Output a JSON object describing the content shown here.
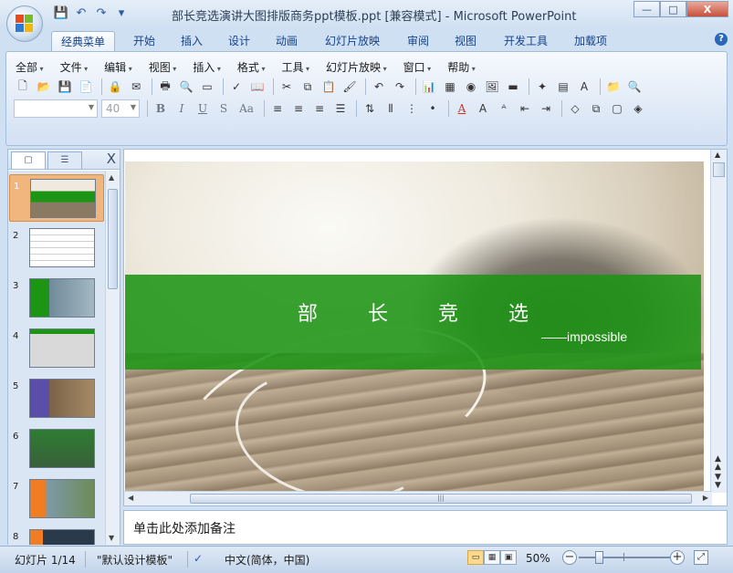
{
  "window": {
    "title": "部长竞选演讲大图排版商务ppt模板.ppt [兼容模式] - Microsoft PowerPoint",
    "controls": {
      "minimize": "—",
      "maximize": "□",
      "close": "X"
    }
  },
  "quick_access": {
    "save": "💾",
    "undo": "↶",
    "redo": "↷",
    "more": "▾"
  },
  "ribbon_tabs": [
    "经典菜单",
    "开始",
    "插入",
    "设计",
    "动画",
    "幻灯片放映",
    "审阅",
    "视图",
    "开发工具",
    "加载项"
  ],
  "active_tab": "经典菜单",
  "help": "?",
  "menu": [
    "全部",
    "文件",
    "编辑",
    "视图",
    "插入",
    "格式",
    "工具",
    "幻灯片放映",
    "窗口",
    "帮助"
  ],
  "font": {
    "name": "",
    "size": "40"
  },
  "format_buttons": {
    "bold": "B",
    "italic": "I",
    "underline": "U",
    "strike": "S",
    "case": "Aa",
    "font_color": "A"
  },
  "left_panel": {
    "tab_slides": "▢",
    "tab_outline": "☰",
    "close": "X",
    "slides": [
      "1",
      "2",
      "3",
      "4",
      "5",
      "6",
      "7",
      "8"
    ],
    "selected": "1"
  },
  "slide": {
    "title": "部长竞选",
    "subtitle": "——impossible"
  },
  "notes": {
    "placeholder": "单击此处添加备注"
  },
  "status": {
    "slide": "幻灯片 1/14",
    "theme": "\"默认设计模板\"",
    "language": "中文(简体，中国)",
    "zoom": "50%",
    "zoom_fraction": 0.45
  },
  "colors": {
    "banner": "#1c9414",
    "ribbon_blue": "#15428b",
    "selected_thumb": "#f1b67e"
  }
}
